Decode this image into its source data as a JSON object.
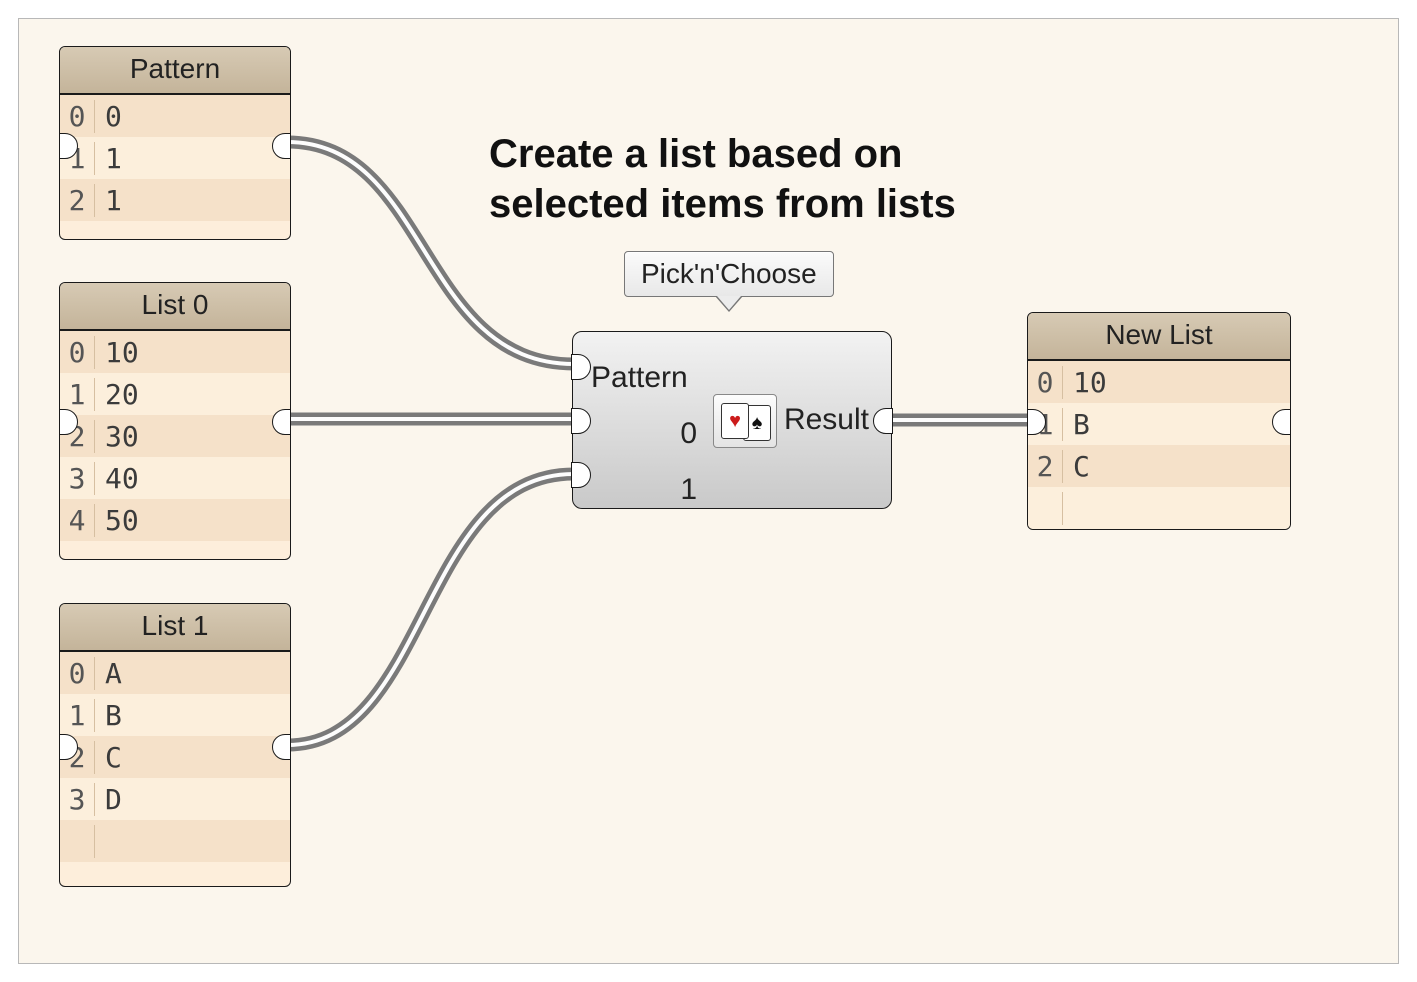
{
  "headline_line1": "Create a list based on",
  "headline_line2": "selected items from lists",
  "tooltip": "Pick'n'Choose",
  "node": {
    "input_labels": [
      "Pattern",
      "0",
      "1"
    ],
    "output_label": "Result"
  },
  "panels": {
    "pattern": {
      "title": "Pattern",
      "rows": [
        {
          "i": "0",
          "v": "0"
        },
        {
          "i": "1",
          "v": "1"
        },
        {
          "i": "2",
          "v": "1"
        }
      ]
    },
    "list0": {
      "title": "List 0",
      "rows": [
        {
          "i": "0",
          "v": "10"
        },
        {
          "i": "1",
          "v": "20"
        },
        {
          "i": "2",
          "v": "30"
        },
        {
          "i": "3",
          "v": "40"
        },
        {
          "i": "4",
          "v": "50"
        }
      ]
    },
    "list1": {
      "title": "List 1",
      "rows": [
        {
          "i": "0",
          "v": "A"
        },
        {
          "i": "1",
          "v": "B"
        },
        {
          "i": "2",
          "v": "C"
        },
        {
          "i": "3",
          "v": "D"
        }
      ]
    },
    "newlist": {
      "title": "New List",
      "rows": [
        {
          "i": "0",
          "v": "10"
        },
        {
          "i": "1",
          "v": "B"
        },
        {
          "i": "2",
          "v": "C"
        }
      ]
    }
  },
  "colors": {
    "panel_bg": "#fdeedb",
    "panel_header": "#cdbfa6",
    "canvas": "#fbf6ed"
  }
}
